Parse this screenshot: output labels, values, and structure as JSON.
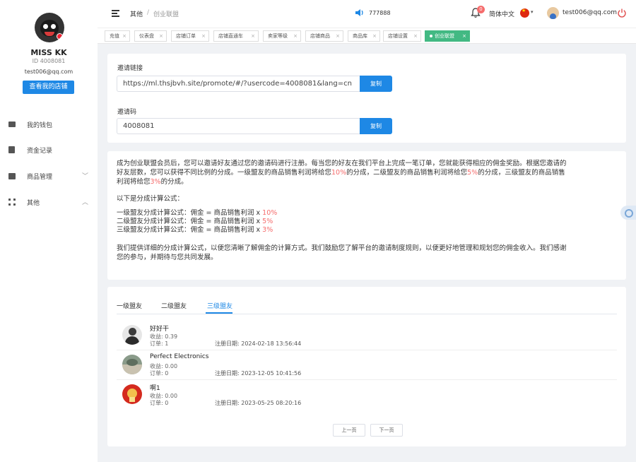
{
  "user": {
    "name": "MISS KK",
    "id": "ID 4008081",
    "email": "test006@qq.com",
    "store_button": "查看我的店铺"
  },
  "sidebar": {
    "items": [
      {
        "label": "我的钱包",
        "icon": "wallet-icon"
      },
      {
        "label": "资金记录",
        "icon": "file-icon"
      },
      {
        "label": "商品管理",
        "icon": "briefcase-icon",
        "chevron": "﹀"
      },
      {
        "label": "其他",
        "icon": "grid-icon",
        "chevron": "︿"
      }
    ]
  },
  "header": {
    "breadcrumb_root": "其他",
    "breadcrumb_sep": "/",
    "breadcrumb_current": "创业联盟",
    "announce_number": "777888",
    "bell_badge": "0",
    "language": "简体中文",
    "language_caret": "▾",
    "account_email": "test006@qq.com"
  },
  "tags": [
    {
      "label": "充值",
      "active": false
    },
    {
      "label": "仪表盘",
      "active": false
    },
    {
      "label": "店铺订单",
      "active": false
    },
    {
      "label": "店铺直通车",
      "active": false
    },
    {
      "label": "卖家等级",
      "active": false
    },
    {
      "label": "店铺商品",
      "active": false
    },
    {
      "label": "商品库",
      "active": false
    },
    {
      "label": "店铺设置",
      "active": false
    },
    {
      "label": "创业联盟",
      "active": true
    }
  ],
  "tag_close": "×",
  "invite": {
    "link_label": "邀请链接",
    "link_value": "https://ml.thsjbvh.site/promote/#/?usercode=4008081&lang=cn",
    "code_label": "邀请码",
    "code_value": "4008081",
    "copy_label": "复制"
  },
  "intro": {
    "p1_a": "成为创业联盟会员后，您可以邀请好友通过您的邀请码进行注册。每当您的好友在我们平台上完成一笔订单，您就能获得相应的佣金奖励。根据您邀请的",
    "p1_b_1": "好友层数，您可以获得不同比例的分成。一级盟友的商品销售利润将给您",
    "p1_b_r1": "10%",
    "p1_b_2": "的分成，二级盟友的商品销售利润将给您",
    "p1_b_r2": "5%",
    "p1_b_3": "的分成，三级盟友的商品销售",
    "p1_c_1": "利润将给您",
    "p1_c_r": "3%",
    "p1_c_2": "的分成。",
    "formula_title": "以下是分成计算公式：",
    "f1": "一级盟友分成计算公式：佣金 = 商品销售利润 x ",
    "f1_r": "10%",
    "f2": "二级盟友分成计算公式：佣金 = 商品销售利润 x ",
    "f2_r": "5%",
    "f3": "三级盟友分成计算公式：佣金 = 商品销售利润 x ",
    "f3_r": "3%",
    "closing_a": "我们提供详细的分成计算公式，以便您清晰了解佣金的计算方式。我们鼓励您了解平台的邀请制度规则，以便更好地管理和规划您的佣金收入。我们感谢",
    "closing_b": "您的参与，并期待与您共同发展。"
  },
  "members_tabs": [
    "一级盟友",
    "二级盟友",
    "三级盟友"
  ],
  "members": [
    {
      "name": "好好干",
      "income": "收益: 0.39",
      "orders": "订单: 1",
      "date": "注册日期: 2024-02-18 13:56:44"
    },
    {
      "name": "Perfect Electronics",
      "income": "收益: 0.00",
      "orders": "订单: 0",
      "date": "注册日期: 2023-12-05 10:41:56"
    },
    {
      "name": "啊1",
      "income": "收益: 0.00",
      "orders": "订单: 0",
      "date": "注册日期: 2023-05-25 08:20:16"
    }
  ],
  "pagination": {
    "prev": "上一页",
    "next": "下一页"
  },
  "colors": {
    "primary": "#1e88e5",
    "active_tag": "#42b983",
    "highlight": "#f56c6c"
  }
}
